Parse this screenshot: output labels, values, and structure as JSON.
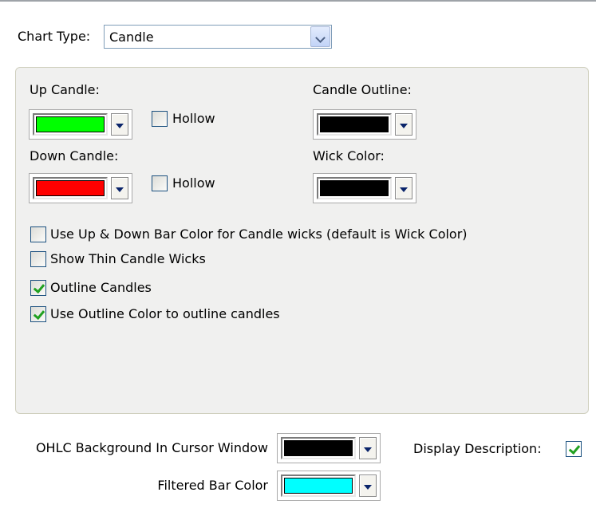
{
  "chart_type": {
    "label": "Chart Type:",
    "value": "Candle"
  },
  "up_candle": {
    "label": "Up Candle:",
    "color": "#00ff00",
    "hollow_label": "Hollow",
    "hollow_checked": false
  },
  "down_candle": {
    "label": "Down Candle:",
    "color": "#ff0000",
    "hollow_label": "Hollow",
    "hollow_checked": false
  },
  "candle_outline": {
    "label": "Candle Outline:",
    "color": "#000000"
  },
  "wick_color": {
    "label": "Wick Color:",
    "color": "#000000"
  },
  "options": [
    {
      "label": "Use Up & Down Bar Color for Candle wicks (default is Wick Color)",
      "checked": false
    },
    {
      "label": "Show Thin Candle Wicks",
      "checked": false
    },
    {
      "label": "Outline Candles",
      "checked": true
    },
    {
      "label": "Use Outline Color to outline candles",
      "checked": true
    }
  ],
  "ohlc_background": {
    "label": "OHLC Background In Cursor Window",
    "color": "#000000"
  },
  "display_description": {
    "label": "Display Description:",
    "checked": true
  },
  "filtered_bar": {
    "label": "Filtered Bar Color",
    "color": "#00ffff"
  },
  "colors": {
    "checkmark": "#21a121",
    "group_background": "#f0f0ef"
  }
}
